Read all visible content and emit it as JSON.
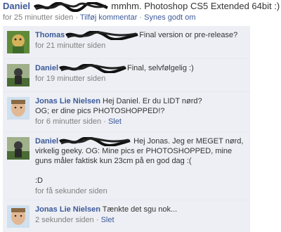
{
  "post": {
    "author": "Daniel",
    "text": "mmhm. Photoshop CS5 Extended 64bit :)",
    "time": "for 25 minutter siden",
    "sep1": "·",
    "add_comment": "Tilføj kommentar",
    "sep2": "·",
    "like": "Synes godt om"
  },
  "comments": [
    {
      "author": "Thomas",
      "text": "Final version or pre-release?",
      "time": "for 21 minutter siden"
    },
    {
      "author": "Daniel",
      "text": "Final, selvfølgelig :)",
      "time": "for 19 minutter siden"
    },
    {
      "author": "Jonas Lie Nielsen",
      "text": "Hej Daniel. Er du LIDT nørd?\nOG; er dine pics PHOTOSHOPPED!?",
      "time": "for 6 minutter siden",
      "sep": "·",
      "delete": "Slet"
    },
    {
      "author": "Daniel",
      "text_a": "Hej Jonas. Jeg er MEGET nørd,",
      "text_b": "virkelig geeky. OG: Mine pics er PHOTOSHOPPED, mine guns måler faktisk kun 23cm på en god dag :(",
      "text_c": ":D",
      "time": "for få sekunder siden"
    },
    {
      "author": "Jonas Lie Nielsen",
      "text": "Tænkte det sgu nok...",
      "time": "2 sekunder siden",
      "sep": "·",
      "delete": "Slet"
    }
  ],
  "colors": {
    "link": "#3b5998",
    "comment_bg": "#edeff4",
    "meta": "#808080"
  }
}
